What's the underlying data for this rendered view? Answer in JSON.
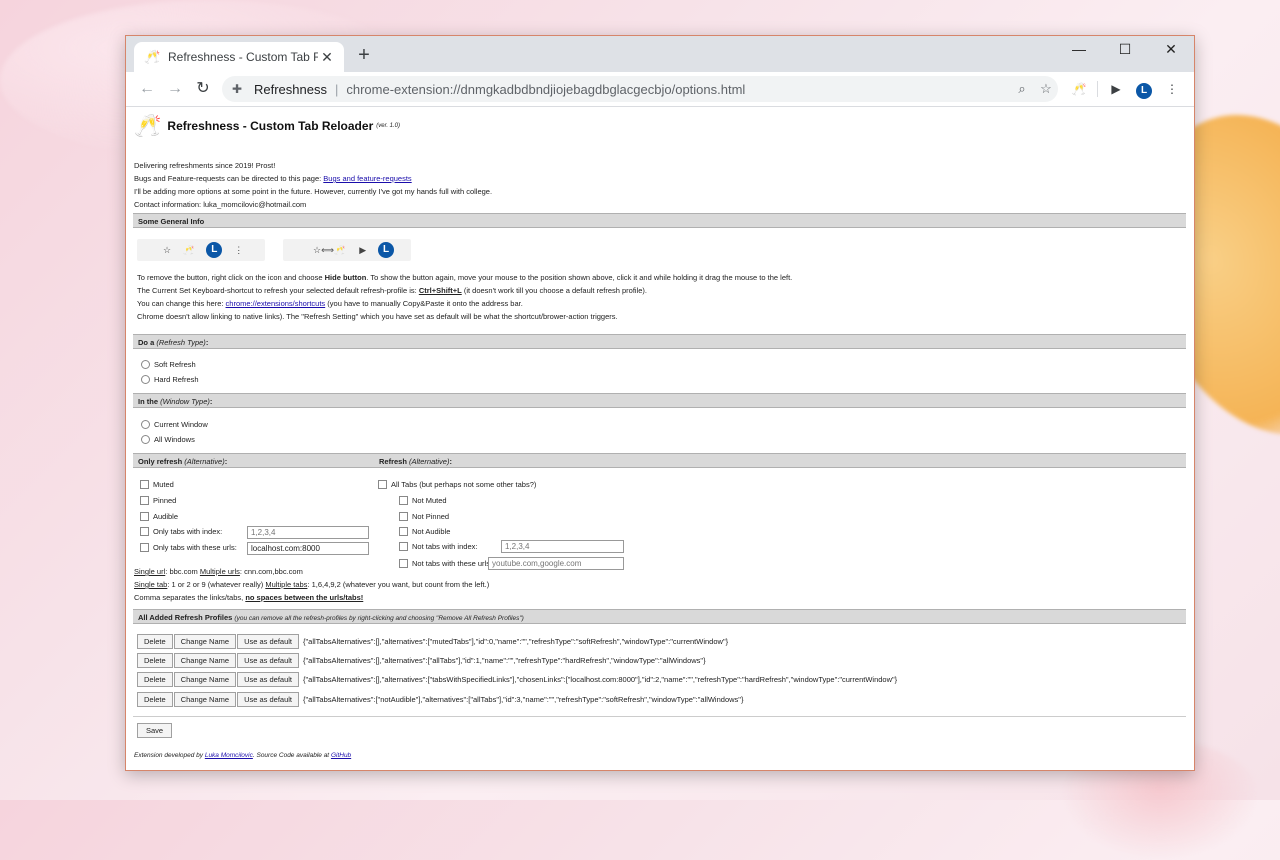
{
  "browser": {
    "tab_title": "Refreshness - Custom Tab Reloader",
    "site_name": "Refreshness",
    "url": "chrome-extension://dnmgkadbdbndjiojebagdbglacgecbjo/options.html",
    "avatar_letter": "L"
  },
  "header": {
    "title": "Refreshness - Custom Tab Reloader",
    "version": "(ver. 1.0)"
  },
  "intro": {
    "line1": "Delivering refreshments since 2019! Prost!",
    "line2_prefix": "Bugs and Feature-requests can be directed to this page: ",
    "line2_link": "Bugs and feature-requests",
    "line3": "I'll be adding more options at some point in the future. However, currently I've got my hands full with college.",
    "line4": "Contact information: luka_momcilovic@hotmail.com"
  },
  "general": {
    "heading": "Some General Info",
    "p1_a": "To remove the button, right click on the icon and choose ",
    "p1_b": "Hide button",
    "p1_c": ". To show the button again, move your mouse to the position shown above, click it and while holding it drag the mouse to the left.",
    "p2_a": "The Current Set Keyboard-shortcut to refresh your selected default refresh-profile is: ",
    "p2_b": "Ctrl+Shift+L",
    "p2_c": " (it doesn't work till you choose a default refresh profile).",
    "p3_a": "You can change this here: ",
    "p3_link": "chrome://extensions/shortcuts",
    "p3_c": " (you have to manually Copy&Paste it onto the address bar.",
    "p4": "Chrome doesn't allow linking to native links). The \"Refresh Setting\" which you have set as default will be what the shortcut/brower-action triggers."
  },
  "refresh_type": {
    "heading_a": "Do a ",
    "heading_b": "(Refresh Type)",
    "heading_c": ":",
    "options": [
      "Soft Refresh",
      "Hard Refresh"
    ]
  },
  "window_type": {
    "heading_a": "In the ",
    "heading_b": "(Window Type)",
    "heading_c": ":",
    "options": [
      "Current Window",
      "All Windows"
    ]
  },
  "only_refresh": {
    "heading_a": "Only refresh ",
    "heading_b": "(Alternative)",
    "heading_c": ":",
    "options": [
      "Muted",
      "Pinned",
      "Audible",
      "Only tabs with index:",
      "Only tabs with these urls:"
    ],
    "index_placeholder": "1,2,3,4",
    "urls_value": "localhost.com:8000"
  },
  "refresh_alt": {
    "heading_a": "Refresh ",
    "heading_b": "(Alternative)",
    "heading_c": ":",
    "all_tabs": "All Tabs (but perhaps not some other tabs?)",
    "options": [
      "Not Muted",
      "Not Pinned",
      "Not Audible",
      "Not tabs with index:",
      "Not tabs with these urls:"
    ],
    "index_placeholder": "1,2,3,4",
    "urls_placeholder": "youtube.com,google.com"
  },
  "help": {
    "single_url_label": "Single url",
    "single_url_text": ": bbc.com ",
    "multiple_urls_label": "Multiple urls",
    "multiple_urls_text": ": cnn.com,bbc.com",
    "single_tab_label": "Single tab",
    "single_tab_text": ": 1 or 2 or 9 (whatever really) ",
    "multiple_tabs_label": "Multiple tabs",
    "multiple_tabs_text": ": 1,6,4,9,2 (whatever you want, but count from the left.)",
    "comma_text": "Comma separates the links/tabs, ",
    "comma_bold": "no spaces between the urls/tabs!"
  },
  "profiles": {
    "heading": "All Added Refresh Profiles",
    "note": "(you can remove all the refresh-profiles by right-clicking and choosing \"Remove All Refresh Profiles\")",
    "delete_label": "Delete",
    "change_label": "Change Name",
    "default_label": "Use as default",
    "rows": [
      "{\"allTabsAlternatives\":[],\"alternatives\":[\"mutedTabs\"],\"id\":0,\"name\":\"\",\"refreshType\":\"softRefresh\",\"windowType\":\"currentWindow\"}",
      "{\"allTabsAlternatives\":[],\"alternatives\":[\"allTabs\"],\"id\":1,\"name\":\"\",\"refreshType\":\"hardRefresh\",\"windowType\":\"allWindows\"}",
      "{\"allTabsAlternatives\":[],\"alternatives\":[\"tabsWithSpecifiedLinks\"],\"chosenLinks\":[\"localhost.com:8000\"],\"id\":2,\"name\":\"\",\"refreshType\":\"hardRefresh\",\"windowType\":\"currentWindow\"}",
      "{\"allTabsAlternatives\":[\"notAudible\"],\"alternatives\":[\"allTabs\"],\"id\":3,\"name\":\"\",\"refreshType\":\"softRefresh\",\"windowType\":\"allWindows\"}"
    ]
  },
  "save_label": "Save",
  "footer": {
    "a": "Extension developed by ",
    "author": "Luka Momcilovic",
    "b": ". Source Code available at ",
    "github": "GitHub"
  }
}
